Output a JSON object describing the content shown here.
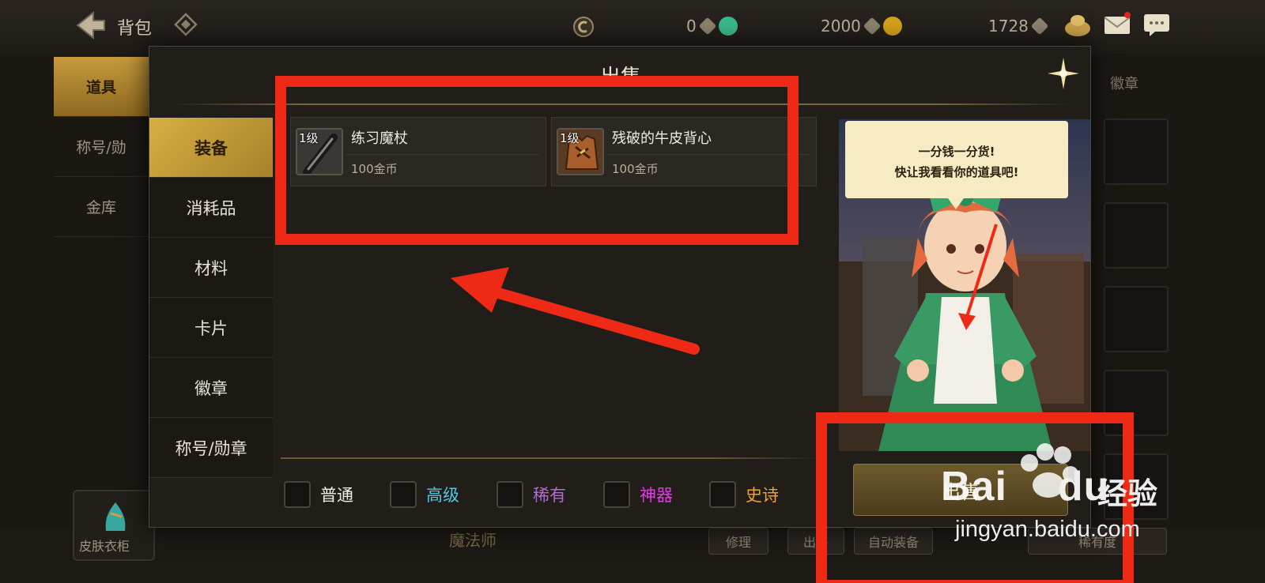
{
  "topbar": {
    "title": "背包",
    "currencies": [
      {
        "value": "0",
        "color": "#3bb98c",
        "icon": "green-gem-icon"
      },
      {
        "value": "2000",
        "color": "#d4a21c",
        "icon": "gold-coin-icon"
      },
      {
        "value": "1728",
        "color": "#c9a14a",
        "icon": "gold-ingot-icon"
      }
    ]
  },
  "left_nav": [
    "道具",
    "称号/勋",
    "金库"
  ],
  "right_tab": "徽章",
  "bottom": {
    "skin_label": "皮肤衣柜",
    "center_text": "魔法师",
    "buttons": [
      "修理",
      "出售",
      "自动装备",
      "稀有度"
    ]
  },
  "dialog": {
    "title": "出售",
    "categories": [
      "装备",
      "消耗品",
      "材料",
      "卡片",
      "徽章",
      "称号/勋章"
    ],
    "items": [
      {
        "level": "1级",
        "name": "练习魔杖",
        "price": "100金币"
      },
      {
        "level": "1级",
        "name": "残破的牛皮背心",
        "price": "100金币"
      }
    ],
    "filters": [
      {
        "label": "普通",
        "color": "#f2eee5"
      },
      {
        "label": "高级",
        "color": "#4ec9e6"
      },
      {
        "label": "稀有",
        "color": "#b16ad6"
      },
      {
        "label": "神器",
        "color": "#e23ee6"
      },
      {
        "label": "史诗",
        "color": "#f2a42a"
      }
    ],
    "speech_line1": "一分钱一分货!",
    "speech_line2": "快让我看看你的道具吧!",
    "sell_button": "出售"
  },
  "watermark": {
    "brand": "Bai",
    "brand2": "du",
    "cn": "经验",
    "url": "jingyan.baidu.com"
  }
}
